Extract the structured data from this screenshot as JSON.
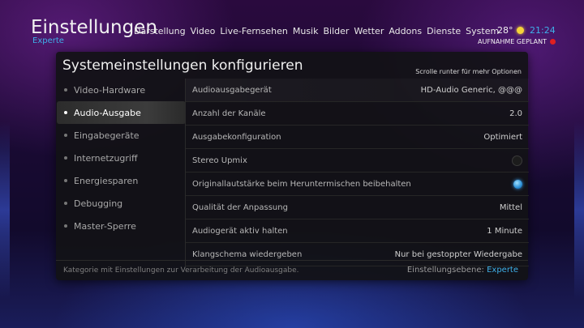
{
  "header": {
    "title": "Einstellungen",
    "level": "Experte"
  },
  "nav": [
    "Darstellung",
    "Video",
    "Live-Fernsehen",
    "Musik",
    "Bilder",
    "Wetter",
    "Addons",
    "Dienste",
    "System"
  ],
  "status": {
    "temperature": "28°",
    "time": "21:24",
    "recording": "AUFNAHME GEPLANT"
  },
  "panel": {
    "title": "Systemeinstellungen konfigurieren",
    "scroll_hint": "Scrolle runter für mehr Optionen"
  },
  "sidebar": {
    "items": [
      {
        "label": "Video-Hardware",
        "active": false
      },
      {
        "label": "Audio-Ausgabe",
        "active": true
      },
      {
        "label": "Eingabegeräte",
        "active": false
      },
      {
        "label": "Internetzugriff",
        "active": false
      },
      {
        "label": "Energiesparen",
        "active": false
      },
      {
        "label": "Debugging",
        "active": false
      },
      {
        "label": "Master-Sperre",
        "active": false
      }
    ]
  },
  "settings": [
    {
      "label": "Audioausgabegerät",
      "value": "HD-Audio Generic, @@@"
    },
    {
      "label": "Anzahl der Kanäle",
      "value": "2.0"
    },
    {
      "label": "Ausgabekonfiguration",
      "value": "Optimiert"
    },
    {
      "label": "Stereo Upmix",
      "toggle": false
    },
    {
      "label": "Originallautstärke beim Heruntermischen beibehalten",
      "toggle": true
    },
    {
      "label": "Qualität der Anpassung",
      "value": "Mittel"
    },
    {
      "label": "Audiogerät aktiv halten",
      "value": "1 Minute"
    },
    {
      "label": "Klangschema wiedergeben",
      "value": "Nur bei gestoppter Wiedergabe"
    }
  ],
  "footer": {
    "description": "Kategorie mit Einstellungen zur Verarbeitung der Audioausgabe.",
    "level_label": "Einstellungsebene:",
    "level_value": "Experte"
  },
  "colors": {
    "accent": "#3fb0e8",
    "record": "#e02020",
    "sun": "#f5d23a"
  }
}
